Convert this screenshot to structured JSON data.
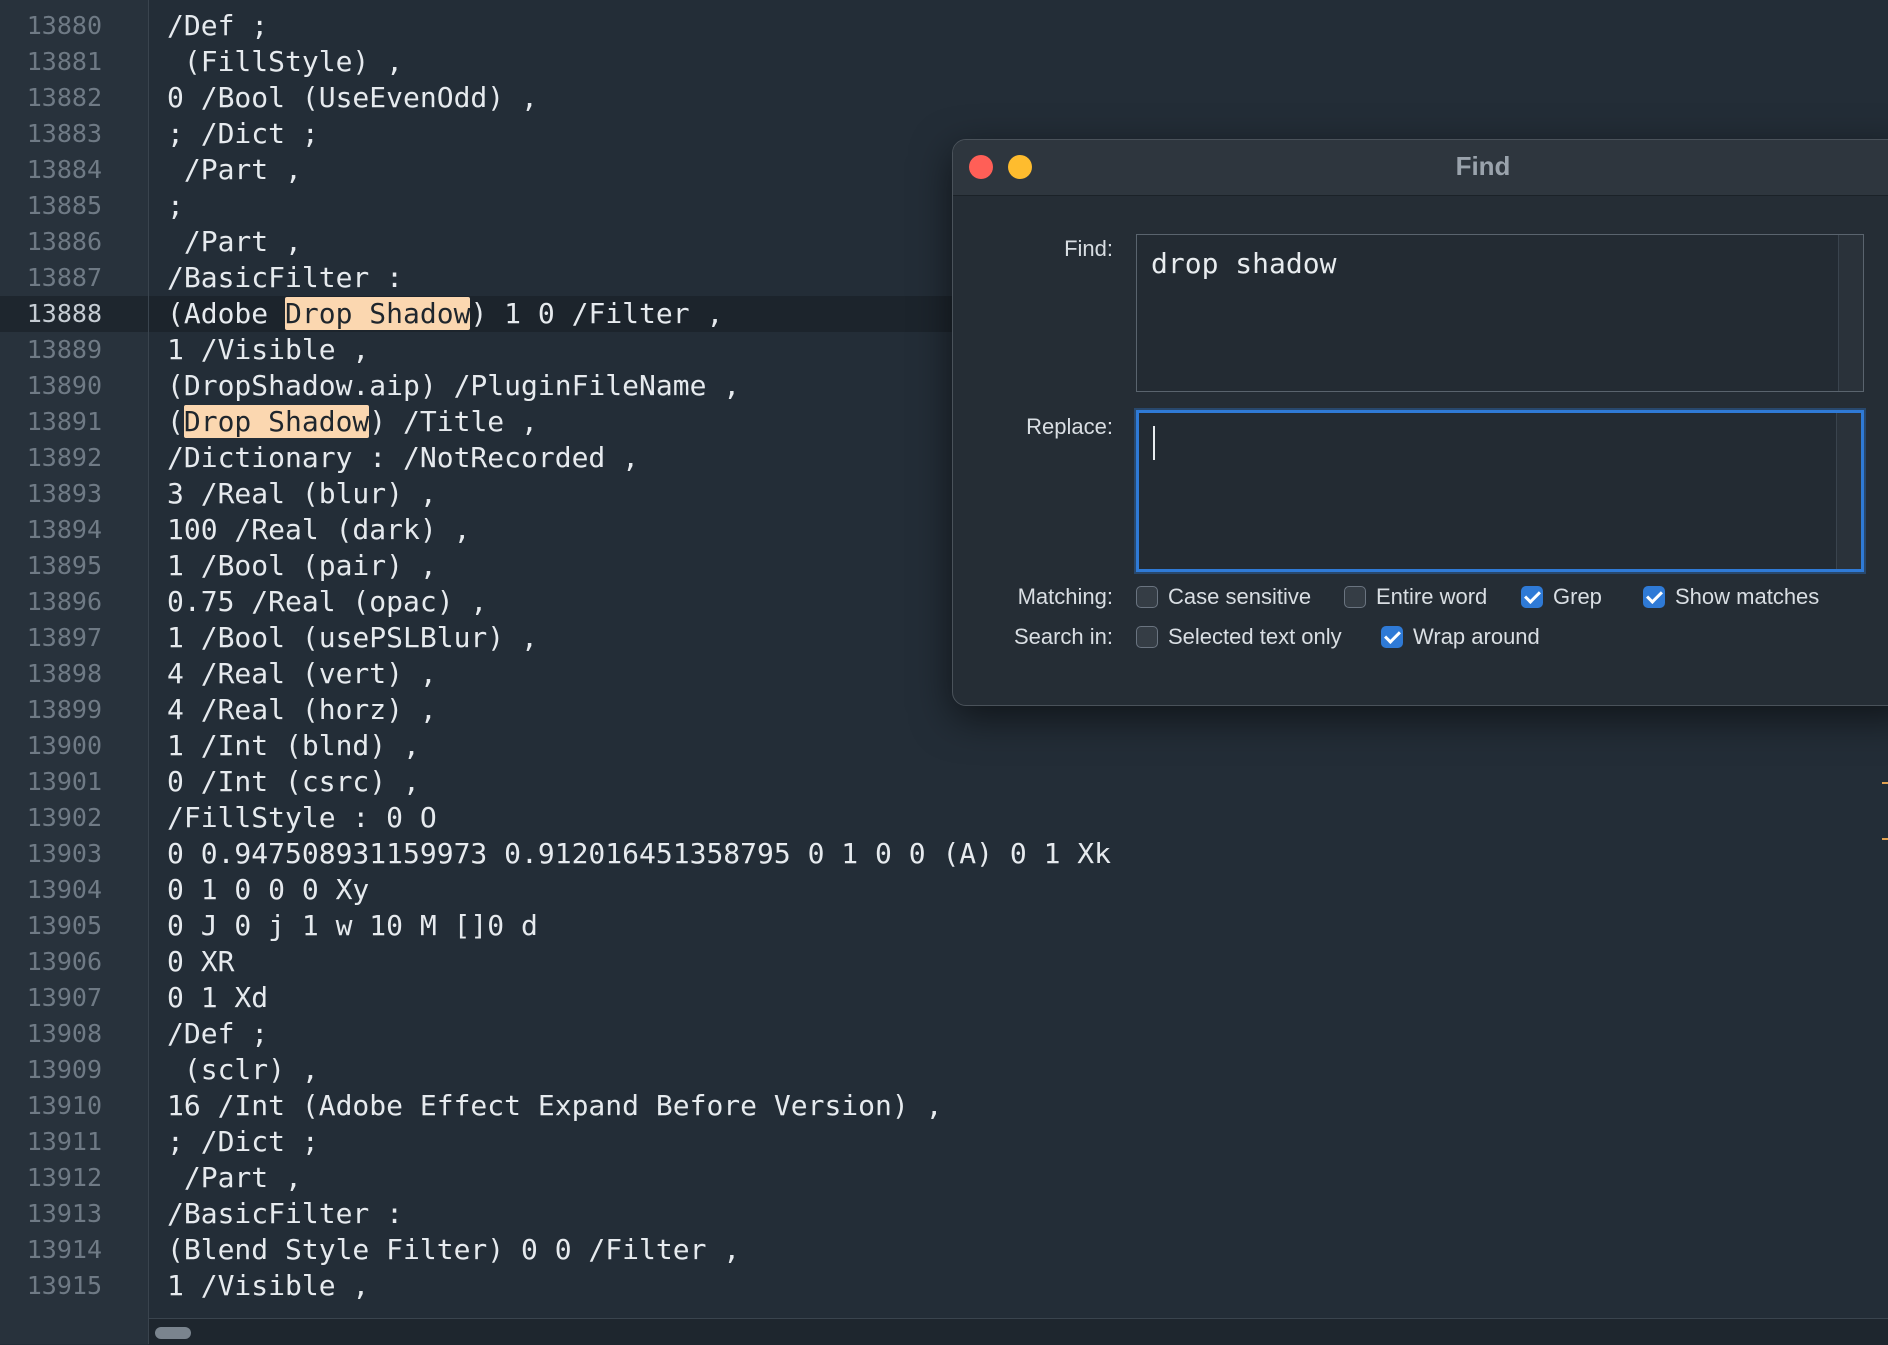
{
  "editor": {
    "current_line_number": "13888",
    "lines": [
      {
        "n": "13880",
        "text": "/Def ;"
      },
      {
        "n": "13881",
        "text": " (FillStyle) ,"
      },
      {
        "n": "13882",
        "text": "0 /Bool (UseEvenOdd) ,"
      },
      {
        "n": "13883",
        "text": "; /Dict ;"
      },
      {
        "n": "13884",
        "text": " /Part ,"
      },
      {
        "n": "13885",
        "text": ";"
      },
      {
        "n": "13886",
        "text": " /Part ,"
      },
      {
        "n": "13887",
        "text": "/BasicFilter :"
      },
      {
        "n": "13888",
        "pre": "(Adobe ",
        "match": "Drop Shadow",
        "post": ") 1 0 /Filter ,"
      },
      {
        "n": "13889",
        "text": "1 /Visible ,"
      },
      {
        "n": "13890",
        "text": "(DropShadow.aip) /PluginFileName ,"
      },
      {
        "n": "13891",
        "pre": "(",
        "match": "Drop Shadow",
        "post": ") /Title ,"
      },
      {
        "n": "13892",
        "text": "/Dictionary : /NotRecorded ,"
      },
      {
        "n": "13893",
        "text": "3 /Real (blur) ,"
      },
      {
        "n": "13894",
        "text": "100 /Real (dark) ,"
      },
      {
        "n": "13895",
        "text": "1 /Bool (pair) ,"
      },
      {
        "n": "13896",
        "text": "0.75 /Real (opac) ,"
      },
      {
        "n": "13897",
        "text": "1 /Bool (usePSLBlur) ,"
      },
      {
        "n": "13898",
        "text": "4 /Real (vert) ,"
      },
      {
        "n": "13899",
        "text": "4 /Real (horz) ,"
      },
      {
        "n": "13900",
        "text": "1 /Int (blnd) ,"
      },
      {
        "n": "13901",
        "text": "0 /Int (csrc) ,"
      },
      {
        "n": "13902",
        "text": "/FillStyle : 0 O"
      },
      {
        "n": "13903",
        "text": "0 0.947508931159973 0.912016451358795 0 1 0 0 (A) 0 1 Xk"
      },
      {
        "n": "13904",
        "text": "0 1 0 0 0 Xy"
      },
      {
        "n": "13905",
        "text": "0 J 0 j 1 w 10 M []0 d"
      },
      {
        "n": "13906",
        "text": "0 XR"
      },
      {
        "n": "13907",
        "text": "0 1 Xd"
      },
      {
        "n": "13908",
        "text": "/Def ;"
      },
      {
        "n": "13909",
        "text": " (sclr) ,"
      },
      {
        "n": "13910",
        "text": "16 /Int (Adobe Effect Expand Before Version) ,"
      },
      {
        "n": "13911",
        "text": "; /Dict ;"
      },
      {
        "n": "13912",
        "text": " /Part ,"
      },
      {
        "n": "13913",
        "text": "/BasicFilter :"
      },
      {
        "n": "13914",
        "text": "(Blend Style Filter) 0 0 /Filter ,"
      },
      {
        "n": "13915",
        "text": "1 /Visible ,"
      }
    ]
  },
  "find_panel": {
    "title": "Find",
    "find_label": "Find:",
    "find_value": "drop shadow",
    "replace_label": "Replace:",
    "replace_value": "",
    "matching_label": "Matching:",
    "search_in_label": "Search in:",
    "options": {
      "case_sensitive": {
        "label": "Case sensitive",
        "checked": false
      },
      "entire_word": {
        "label": "Entire word",
        "checked": false
      },
      "grep": {
        "label": "Grep",
        "checked": true
      },
      "show_matches": {
        "label": "Show matches",
        "checked": true
      },
      "selected_text_only": {
        "label": "Selected text only",
        "checked": false
      },
      "wrap_around": {
        "label": "Wrap around",
        "checked": true
      }
    }
  },
  "colors": {
    "background": "#232d37",
    "match_highlight": "#fbd7b0",
    "accent": "#2f7ad6",
    "close_button": "#ff5f57",
    "minimize_button": "#febc2e"
  }
}
